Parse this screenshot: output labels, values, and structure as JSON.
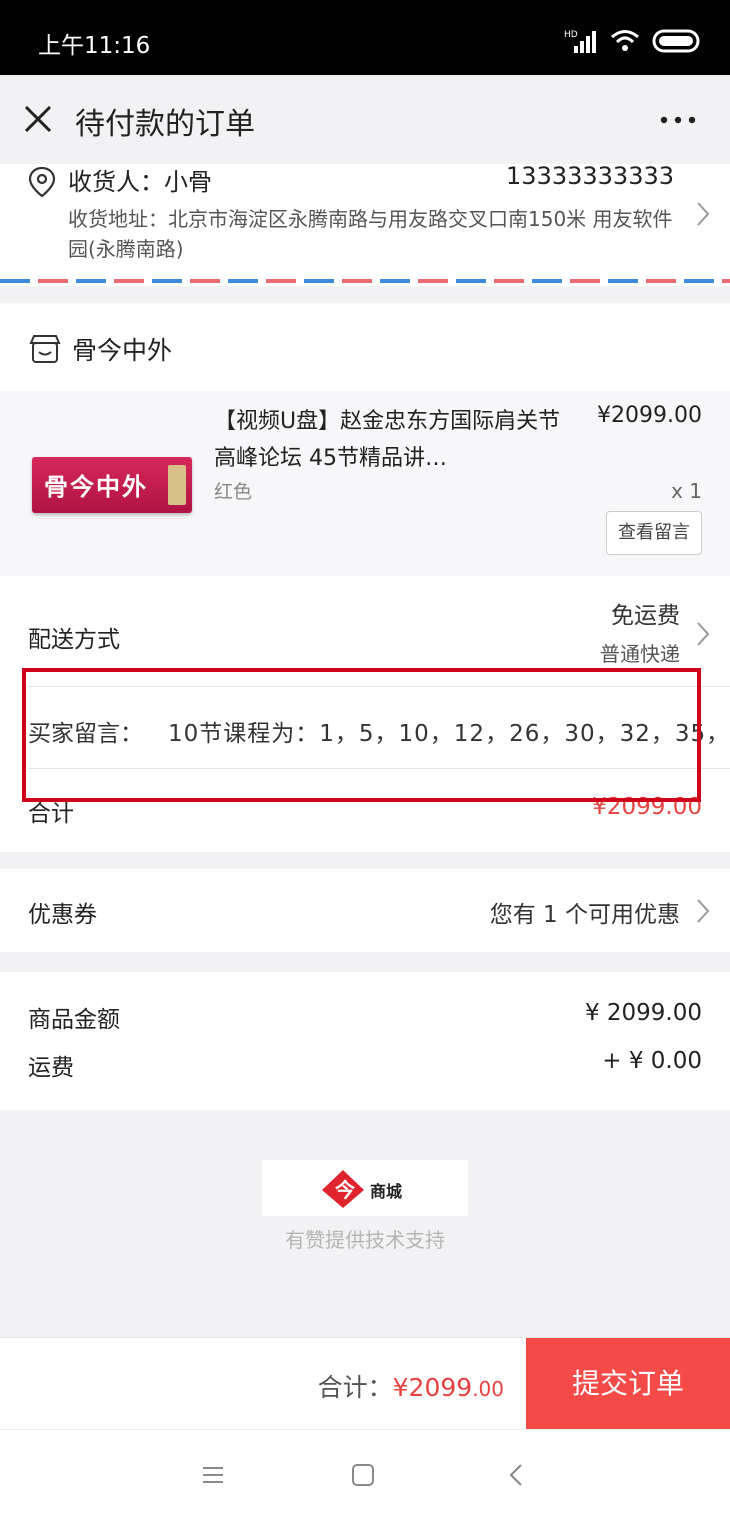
{
  "status_bar": {
    "time": "上午11:16",
    "icons": [
      "hd-signal-icon",
      "wifi-icon",
      "battery-icon"
    ]
  },
  "title_bar": {
    "title": "待付款的订单",
    "close_icon": "close-icon",
    "more_icon": "more-icon"
  },
  "address": {
    "receiver": "收货人：小骨",
    "phone": "13333333333",
    "detail": "收货地址：北京市海淀区永腾南路与用友路交叉口南150米 用友软件园(永腾南路)"
  },
  "shop": {
    "name": "骨今中外"
  },
  "product": {
    "image_text": "骨今中外",
    "title": "【视频U盘】赵金忠东方国际肩关节高峰论坛 45节精品讲…",
    "price": "¥2099.00",
    "spec": "红色",
    "qty": "x 1",
    "view_message_button": "查看留言"
  },
  "shipping": {
    "label": "配送方式",
    "value": "免运费",
    "sub": "普通快递",
    "message_label": "买家留言：",
    "message_value": "10节课程为：1，5，10，12，26，30，32，35，",
    "total_label": "合计",
    "total_value": "¥2099.00"
  },
  "coupon": {
    "label": "优惠券",
    "value": "您有 1 个可用优惠"
  },
  "summary": {
    "goods_label": "商品金额",
    "goods_value": "¥ 2099.00",
    "freight_label": "运费",
    "freight_value": "+ ¥ 0.00"
  },
  "branding": {
    "logo_text": "商城",
    "support": "有赞提供技术支持"
  },
  "footer": {
    "total_label": "合计：",
    "total_price": "¥2099",
    "total_cents": ".00",
    "submit": "提交订单"
  },
  "colors": {
    "accent_red": "#f44a48",
    "price_red": "#e64340",
    "highlight_border": "#d0021b"
  }
}
